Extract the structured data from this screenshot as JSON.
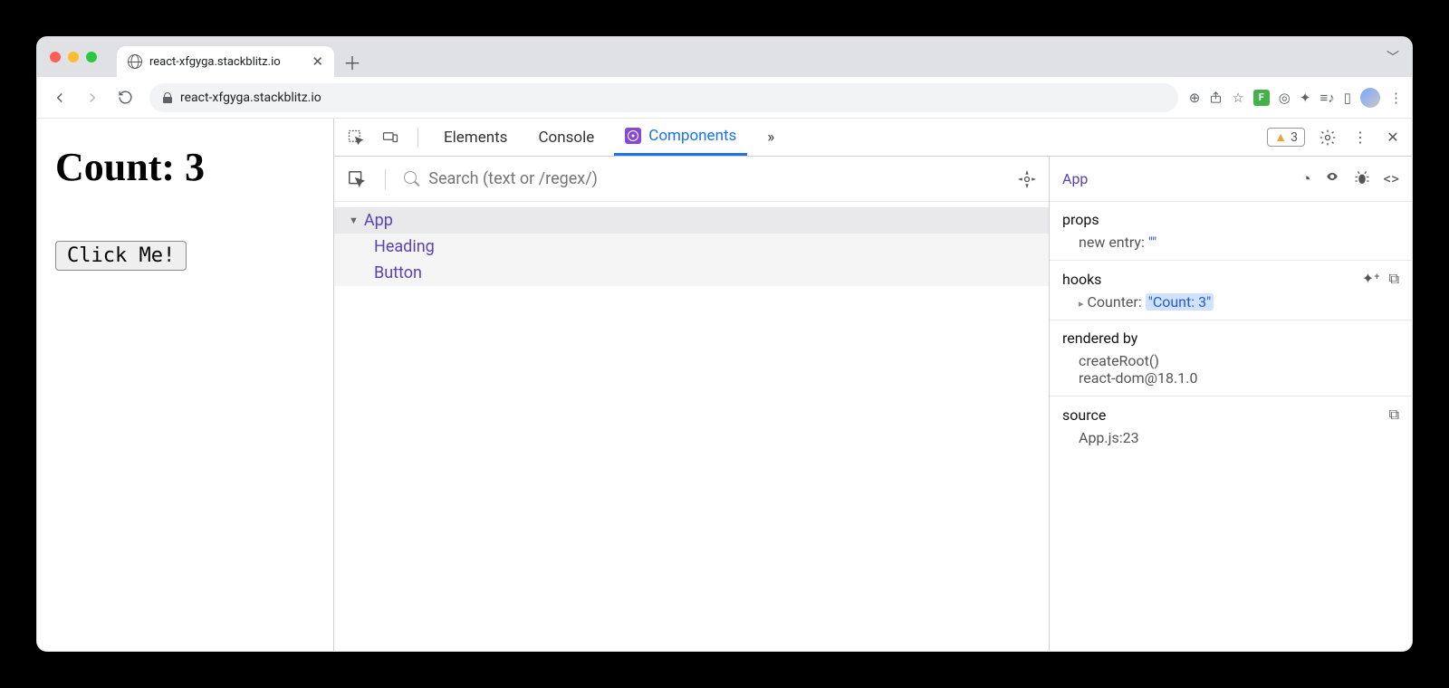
{
  "browser": {
    "tab_title": "react-xfgyga.stackblitz.io",
    "url": "react-xfgyga.stackblitz.io"
  },
  "page": {
    "heading": "Count: 3",
    "button": "Click Me!"
  },
  "devtools": {
    "tabs": {
      "elements": "Elements",
      "console": "Console",
      "components": "Components"
    },
    "more": "»",
    "warnings": "3",
    "search_placeholder": "Search (text or /regex/)",
    "tree": {
      "root": "App",
      "children": [
        "Heading",
        "Button"
      ]
    },
    "inspector": {
      "selected": "App",
      "props_label": "props",
      "props_entry_key": "new entry",
      "props_entry_val": "\"\"",
      "hooks_label": "hooks",
      "hook_name": "Counter",
      "hook_val": "\"Count: 3\"",
      "rendered_label": "rendered by",
      "rendered_1": "createRoot()",
      "rendered_2": "react-dom@18.1.0",
      "source_label": "source",
      "source_val": "App.js:23"
    }
  }
}
